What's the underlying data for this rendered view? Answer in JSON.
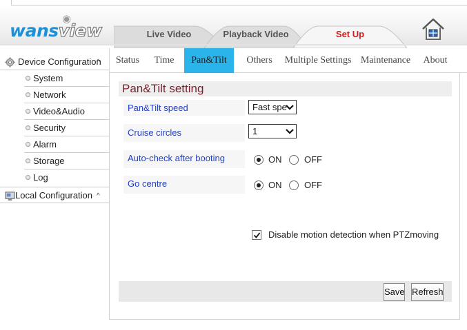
{
  "header": {
    "logo_text": "wansview",
    "nav": {
      "live_video": "Live Video",
      "playback_video": "Playback Video",
      "set_up": "Set Up"
    }
  },
  "sidebar": {
    "device_configuration": "Device Configuration",
    "items": [
      "System",
      "Network",
      "Video&Audio",
      "Security",
      "Alarm",
      "Storage",
      "Log"
    ],
    "local_configuration": "Local Configuration",
    "caret": "^"
  },
  "subtabs": [
    "Status",
    "Time",
    "Pan&Tilt",
    "Others",
    "Multiple Settings",
    "Maintenance",
    "About"
  ],
  "active_subtab": "Pan&Tilt",
  "panel": {
    "title": "Pan&Tilt setting",
    "speed_label": "Pan&Tilt speed",
    "speed_value": "Fast spe",
    "cruise_label": "Cruise circles",
    "cruise_value": "1",
    "autocheck_label": "Auto-check after booting",
    "autocheck_on": "ON",
    "autocheck_off": "OFF",
    "autocheck_selected": "ON",
    "gocentre_label": "Go centre",
    "gocentre_on": "ON",
    "gocentre_off": "OFF",
    "gocentre_selected": "ON",
    "disable_motion_label": "Disable motion detection when PTZmoving",
    "disable_motion_checked": true,
    "save_label": "Save",
    "refresh_label": "Refresh"
  },
  "colors": {
    "accent_tab": "#2ab4ea",
    "set_up_text": "#d21b1b",
    "label_blue": "#1f3fc4",
    "title_maroon": "#7a1f2a",
    "logo_blue": "#1f8fd6"
  }
}
